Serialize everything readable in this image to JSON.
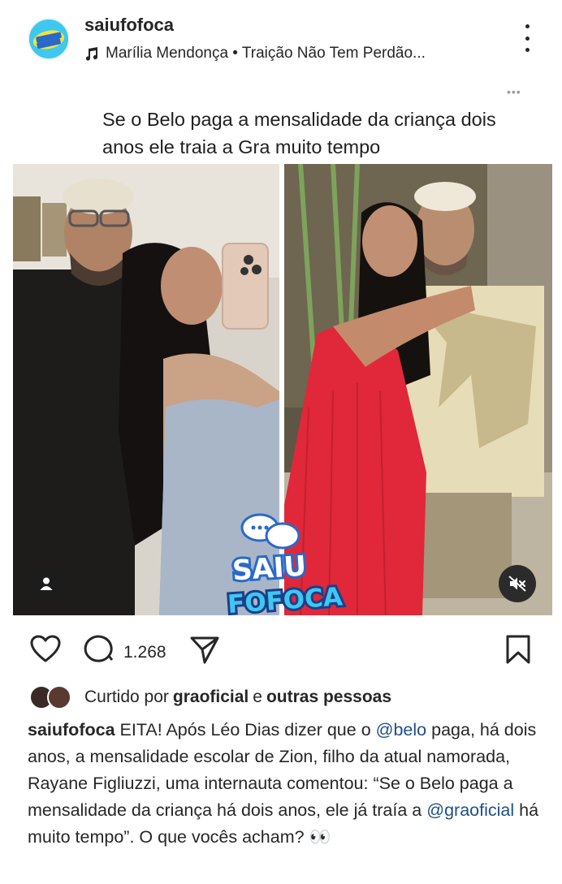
{
  "header": {
    "username": "saiufofoca",
    "music": "Marília Mendonça • Traição Não Tem Perdão..."
  },
  "post": {
    "more_dots": "•••",
    "headline": "Se o Belo paga a mensalidade da criança dois anos ele traia a Gra muito tempo",
    "logo_lines": [
      "SAIU",
      "FOFOCA"
    ]
  },
  "actions": {
    "comment_count": "1.268"
  },
  "likes": {
    "prefix": "Curtido por",
    "user": "graoficial",
    "connector": "e",
    "others": "outras pessoas"
  },
  "caption": {
    "author": "saiufofoca",
    "part1": "EITA! Após Léo Dias dizer que o",
    "mention1": "@belo",
    "part2": "paga, há dois anos, a mensalidade escolar de Zion, filho da atual namorada, Rayane Figliuzzi, uma internauta comentou: “Se o Belo paga a mensalidade da criança há dois anos, ele já traía a",
    "mention2": "@graoficial",
    "part3": "há muito tempo”. O que vocês acham? 👀"
  },
  "colors": {
    "avatar_bg": "#3ec8ef",
    "mention": "#1f4f8a",
    "red_dress": "#e0283a"
  }
}
